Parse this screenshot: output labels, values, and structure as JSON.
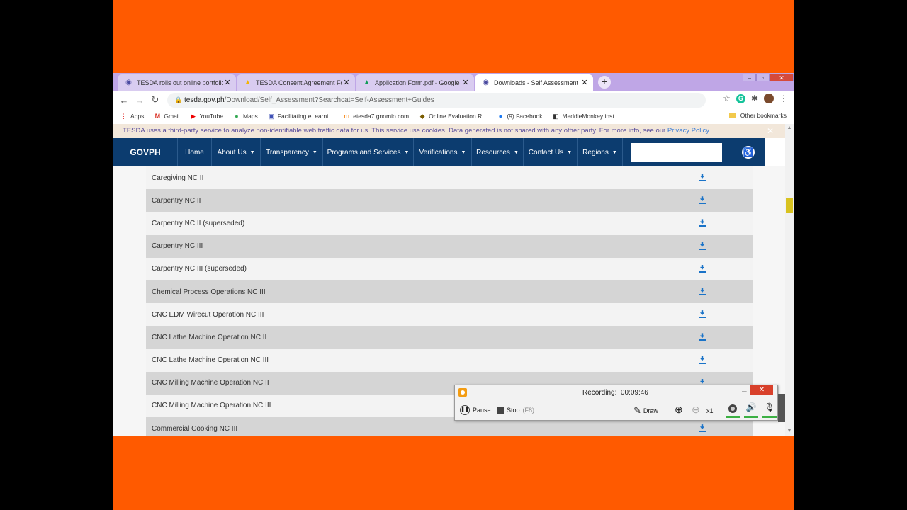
{
  "browser": {
    "tabs": [
      {
        "label": "TESDA rolls out online portfolio a",
        "icon": "tesda-favicon",
        "active": false
      },
      {
        "label": "TESDA Consent Agreement Form",
        "icon": "google-drive-icon",
        "active": false
      },
      {
        "label": "Application Form.pdf - Google D",
        "icon": "google-drive-icon",
        "active": false
      },
      {
        "label": "Downloads - Self Assessment Gu",
        "icon": "tesda-favicon",
        "active": true
      }
    ],
    "new_tab": "+",
    "url_host": "tesda.gov.ph",
    "url_path": "/Download/Self_Assessment?Searchcat=Self-Assessment+Guides",
    "bookmarks": [
      {
        "label": "Apps",
        "icon": "apps-grid-icon"
      },
      {
        "label": "Gmail",
        "icon": "gmail-icon"
      },
      {
        "label": "YouTube",
        "icon": "youtube-icon"
      },
      {
        "label": "Maps",
        "icon": "maps-pin-icon"
      },
      {
        "label": "Facilitating eLearni...",
        "icon": "elearning-icon"
      },
      {
        "label": "etesda7.gnomio.com",
        "icon": "moodle-icon"
      },
      {
        "label": "Online Evaluation R...",
        "icon": "evaluation-icon"
      },
      {
        "label": "(9) Facebook",
        "icon": "facebook-icon"
      },
      {
        "label": "MeddleMonkey inst...",
        "icon": "monkey-icon"
      }
    ],
    "other_bookmarks": "Other bookmarks"
  },
  "cookie_notice": {
    "text": "TESDA uses a third-party service to analyze non-identifiable web traffic data for us. This service use cookies. Data generated is not shared with any other party. For more info, see our ",
    "link": "Privacy Policy",
    "end": "."
  },
  "nav": {
    "brand": "GOVPH",
    "items": [
      {
        "label": "Home",
        "dropdown": false
      },
      {
        "label": "About Us",
        "dropdown": true
      },
      {
        "label": "Transparency",
        "dropdown": true
      },
      {
        "label": "Programs and Services",
        "dropdown": true
      },
      {
        "label": "Verifications",
        "dropdown": true
      },
      {
        "label": "Resources",
        "dropdown": true
      },
      {
        "label": "Contact Us",
        "dropdown": true
      },
      {
        "label": "Regions",
        "dropdown": true
      }
    ],
    "search_value": ""
  },
  "downloads": [
    "Caregiving NC II",
    "Carpentry NC II",
    "Carpentry NC II (superseded)",
    "Carpentry NC III",
    "Carpentry NC III (superseded)",
    "Chemical Process Operations NC III",
    "CNC EDM Wirecut Operation NC III",
    "CNC Lathe Machine Operation NC II",
    "CNC Lathe Machine Operation NC III",
    "CNC Milling Machine Operation NC II",
    "CNC Milling Machine Operation NC III",
    "Commercial Cooking NC III"
  ],
  "recorder": {
    "status_label": "Recording:",
    "time": "00:09:46",
    "pause": "Pause",
    "stop": "Stop",
    "stop_hotkey": "(F8)",
    "draw": "Draw",
    "zoom_level": "x1"
  },
  "colors": {
    "frame": "#FF5A00",
    "nav_bg": "#0C3C6F",
    "download_icon": "#1A73C8",
    "link": "#3A7BD5"
  }
}
